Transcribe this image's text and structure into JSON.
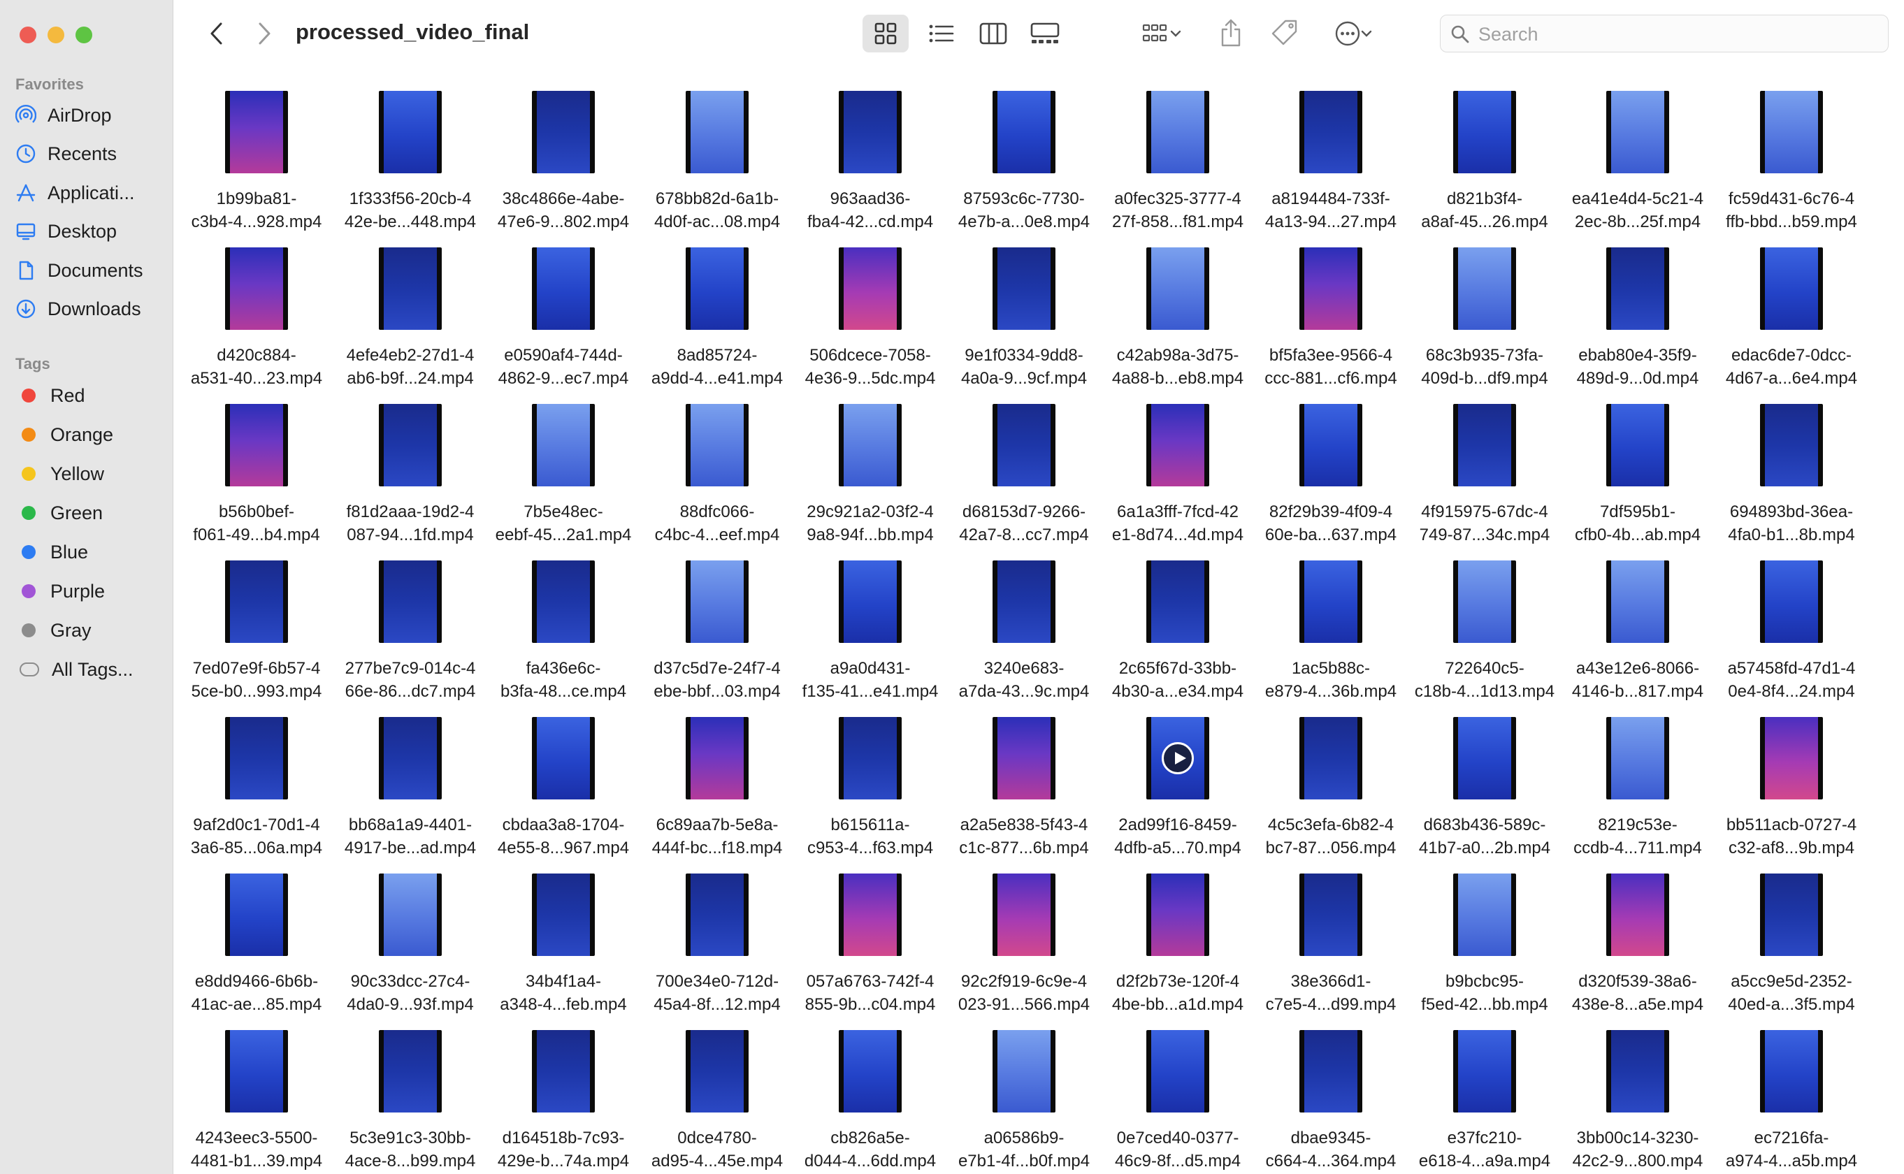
{
  "window": {
    "title": "processed_video_final"
  },
  "sidebar": {
    "favorites_title": "Favorites",
    "favorites": [
      {
        "label": "AirDrop",
        "icon": "airdrop-icon"
      },
      {
        "label": "Recents",
        "icon": "clock-icon"
      },
      {
        "label": "Applicati...",
        "icon": "applications-icon"
      },
      {
        "label": "Desktop",
        "icon": "desktop-icon"
      },
      {
        "label": "Documents",
        "icon": "document-icon"
      },
      {
        "label": "Downloads",
        "icon": "download-icon"
      }
    ],
    "tags_title": "Tags",
    "tags": [
      {
        "label": "Red",
        "color": "#f0463c"
      },
      {
        "label": "Orange",
        "color": "#f38b15"
      },
      {
        "label": "Yellow",
        "color": "#f5c51d"
      },
      {
        "label": "Green",
        "color": "#2bb84a"
      },
      {
        "label": "Blue",
        "color": "#2d7cf2"
      },
      {
        "label": "Purple",
        "color": "#a155d6"
      },
      {
        "label": "Gray",
        "color": "#8c8c8c"
      },
      {
        "label": "All Tags...",
        "color": ""
      }
    ]
  },
  "toolbar": {
    "back": "chevron-left-icon",
    "forward": "chevron-right-icon",
    "views": [
      "icon-view-icon",
      "list-view-icon",
      "column-view-icon",
      "gallery-view-icon"
    ],
    "active_view": "icon-view-icon",
    "group": "group-icon",
    "share": "share-icon",
    "tag": "tag-icon",
    "more": "more-icon"
  },
  "search": {
    "placeholder": "Search",
    "value": ""
  },
  "files": [
    {
      "line1": "1b99ba81-",
      "line2": "c3b4-4...928.mp4",
      "tint": "purple"
    },
    {
      "line1": "1f333f56-20cb-4",
      "line2": "42e-be...448.mp4",
      "tint": "blue"
    },
    {
      "line1": "38c4866e-4abe-",
      "line2": "47e6-9...802.mp4",
      "tint": "navy"
    },
    {
      "line1": "678bb82d-6a1b-",
      "line2": "4d0f-ac...08.mp4",
      "tint": "light"
    },
    {
      "line1": "963aad36-",
      "line2": "fba4-42...cd.mp4",
      "tint": "navy"
    },
    {
      "line1": "87593c6c-7730-",
      "line2": "4e7b-a...0e8.mp4",
      "tint": "blue"
    },
    {
      "line1": "a0fec325-3777-4",
      "line2": "27f-858...f81.mp4",
      "tint": "light"
    },
    {
      "line1": "a8194484-733f-",
      "line2": "4a13-94...27.mp4",
      "tint": "navy"
    },
    {
      "line1": "d821b3f4-",
      "line2": "a8af-45...26.mp4",
      "tint": "blue"
    },
    {
      "line1": "ea41e4d4-5c21-4",
      "line2": "2ec-8b...25f.mp4",
      "tint": "light"
    },
    {
      "line1": "fc59d431-6c76-4",
      "line2": "ffb-bbd...b59.mp4",
      "tint": "light"
    },
    {
      "line1": "d420c884-",
      "line2": "a531-40...23.mp4",
      "tint": "purple"
    },
    {
      "line1": "4efe4eb2-27d1-4",
      "line2": "ab6-b9f...24.mp4",
      "tint": "navy"
    },
    {
      "line1": "e0590af4-744d-",
      "line2": "4862-9...ec7.mp4",
      "tint": "blue"
    },
    {
      "line1": "8ad85724-",
      "line2": "a9dd-4...e41.mp4",
      "tint": "blue"
    },
    {
      "line1": "506dcece-7058-",
      "line2": "4e36-9...5dc.mp4",
      "tint": "pink"
    },
    {
      "line1": "9e1f0334-9dd8-",
      "line2": "4a0a-9...9cf.mp4",
      "tint": "navy"
    },
    {
      "line1": "c42ab98a-3d75-",
      "line2": "4a88-b...eb8.mp4",
      "tint": "light"
    },
    {
      "line1": "bf5fa3ee-9566-4",
      "line2": "ccc-881...cf6.mp4",
      "tint": "purple"
    },
    {
      "line1": "68c3b935-73fa-",
      "line2": "409d-b...df9.mp4",
      "tint": "light"
    },
    {
      "line1": "ebab80e4-35f9-",
      "line2": "489d-9...0d.mp4",
      "tint": "navy"
    },
    {
      "line1": "edac6de7-0dcc-",
      "line2": "4d67-a...6e4.mp4",
      "tint": "blue"
    },
    {
      "line1": "b56b0bef-",
      "line2": "f061-49...b4.mp4",
      "tint": "purple"
    },
    {
      "line1": "f81d2aaa-19d2-4",
      "line2": "087-94...1fd.mp4",
      "tint": "navy"
    },
    {
      "line1": "7b5e48ec-",
      "line2": "eebf-45...2a1.mp4",
      "tint": "light"
    },
    {
      "line1": "88dfc066-",
      "line2": "c4bc-4...eef.mp4",
      "tint": "light"
    },
    {
      "line1": "29c921a2-03f2-4",
      "line2": "9a8-94f...bb.mp4",
      "tint": "light"
    },
    {
      "line1": "d68153d7-9266-",
      "line2": "42a7-8...cc7.mp4",
      "tint": "navy"
    },
    {
      "line1": "6a1a3fff-7fcd-42",
      "line2": "e1-8d74...4d.mp4",
      "tint": "purple"
    },
    {
      "line1": "82f29b39-4f09-4",
      "line2": "60e-ba...637.mp4",
      "tint": "blue"
    },
    {
      "line1": "4f915975-67dc-4",
      "line2": "749-87...34c.mp4",
      "tint": "navy"
    },
    {
      "line1": "7df595b1-",
      "line2": "cfb0-4b...ab.mp4",
      "tint": "blue"
    },
    {
      "line1": "694893bd-36ea-",
      "line2": "4fa0-b1...8b.mp4",
      "tint": "navy"
    },
    {
      "line1": "7ed07e9f-6b57-4",
      "line2": "5ce-b0...993.mp4",
      "tint": "navy"
    },
    {
      "line1": "277be7c9-014c-4",
      "line2": "66e-86...dc7.mp4",
      "tint": "navy"
    },
    {
      "line1": "fa436e6c-",
      "line2": "b3fa-48...ce.mp4",
      "tint": "navy"
    },
    {
      "line1": "d37c5d7e-24f7-4",
      "line2": "ebe-bbf...03.mp4",
      "tint": "light"
    },
    {
      "line1": "a9a0d431-",
      "line2": "f135-41...e41.mp4",
      "tint": "blue"
    },
    {
      "line1": "3240e683-",
      "line2": "a7da-43...9c.mp4",
      "tint": "navy"
    },
    {
      "line1": "2c65f67d-33bb-",
      "line2": "4b30-a...e34.mp4",
      "tint": "navy"
    },
    {
      "line1": "1ac5b88c-",
      "line2": "e879-4...36b.mp4",
      "tint": "blue"
    },
    {
      "line1": "722640c5-",
      "line2": "c18b-4...1d13.mp4",
      "tint": "light"
    },
    {
      "line1": "a43e12e6-8066-",
      "line2": "4146-b...817.mp4",
      "tint": "light"
    },
    {
      "line1": "a57458fd-47d1-4",
      "line2": "0e4-8f4...24.mp4",
      "tint": "blue"
    },
    {
      "line1": "9af2d0c1-70d1-4",
      "line2": "3a6-85...06a.mp4",
      "tint": "navy"
    },
    {
      "line1": "bb68a1a9-4401-",
      "line2": "4917-be...ad.mp4",
      "tint": "navy"
    },
    {
      "line1": "cbdaa3a8-1704-",
      "line2": "4e55-8...967.mp4",
      "tint": "blue"
    },
    {
      "line1": "6c89aa7b-5e8a-",
      "line2": "444f-bc...f18.mp4",
      "tint": "purple"
    },
    {
      "line1": "b615611a-",
      "line2": "c953-4...f63.mp4",
      "tint": "navy"
    },
    {
      "line1": "a2a5e838-5f43-4",
      "line2": "c1c-877...6b.mp4",
      "tint": "purple"
    },
    {
      "line1": "2ad99f16-8459-",
      "line2": "4dfb-a5...70.mp4",
      "tint": "blue",
      "play": true
    },
    {
      "line1": "4c5c3efa-6b82-4",
      "line2": "bc7-87...056.mp4",
      "tint": "navy"
    },
    {
      "line1": "d683b436-589c-",
      "line2": "41b7-a0...2b.mp4",
      "tint": "blue"
    },
    {
      "line1": "8219c53e-",
      "line2": "ccdb-4...711.mp4",
      "tint": "light"
    },
    {
      "line1": "bb511acb-0727-4",
      "line2": "c32-af8...9b.mp4",
      "tint": "pink"
    },
    {
      "line1": "e8dd9466-6b6b-",
      "line2": "41ac-ae...85.mp4",
      "tint": "blue"
    },
    {
      "line1": "90c33dcc-27c4-",
      "line2": "4da0-9...93f.mp4",
      "tint": "light"
    },
    {
      "line1": "34b4f1a4-",
      "line2": "a348-4...feb.mp4",
      "tint": "navy"
    },
    {
      "line1": "700e34e0-712d-",
      "line2": "45a4-8f...12.mp4",
      "tint": "navy"
    },
    {
      "line1": "057a6763-742f-4",
      "line2": "855-9b...c04.mp4",
      "tint": "pink"
    },
    {
      "line1": "92c2f919-6c9e-4",
      "line2": "023-91...566.mp4",
      "tint": "pink"
    },
    {
      "line1": "d2f2b73e-120f-4",
      "line2": "4be-bb...a1d.mp4",
      "tint": "purple"
    },
    {
      "line1": "38e366d1-",
      "line2": "c7e5-4...d99.mp4",
      "tint": "navy"
    },
    {
      "line1": "b9bcbc95-",
      "line2": "f5ed-42...bb.mp4",
      "tint": "light"
    },
    {
      "line1": "d320f539-38a6-",
      "line2": "438e-8...a5e.mp4",
      "tint": "pink"
    },
    {
      "line1": "a5cc9e5d-2352-",
      "line2": "40ed-a...3f5.mp4",
      "tint": "navy"
    },
    {
      "line1": "4243eec3-5500-",
      "line2": "4481-b1...39.mp4",
      "tint": "blue"
    },
    {
      "line1": "5c3e91c3-30bb-",
      "line2": "4ace-8...b99.mp4",
      "tint": "navy"
    },
    {
      "line1": "d164518b-7c93-",
      "line2": "429e-b...74a.mp4",
      "tint": "navy"
    },
    {
      "line1": "0dce4780-",
      "line2": "ad95-4...45e.mp4",
      "tint": "navy"
    },
    {
      "line1": "cb826a5e-",
      "line2": "d044-4...6dd.mp4",
      "tint": "blue"
    },
    {
      "line1": "a06586b9-",
      "line2": "e7b1-4f...b0f.mp4",
      "tint": "light"
    },
    {
      "line1": "0e7ced40-0377-",
      "line2": "46c9-8f...d5.mp4",
      "tint": "blue"
    },
    {
      "line1": "dbae9345-",
      "line2": "c664-4...364.mp4",
      "tint": "navy"
    },
    {
      "line1": "e37fc210-",
      "line2": "e618-4...a9a.mp4",
      "tint": "blue"
    },
    {
      "line1": "3bb00c14-3230-",
      "line2": "42c2-9...800.mp4",
      "tint": "navy"
    },
    {
      "line1": "ec7216fa-",
      "line2": "a974-4...a5b.mp4",
      "tint": "blue"
    }
  ]
}
